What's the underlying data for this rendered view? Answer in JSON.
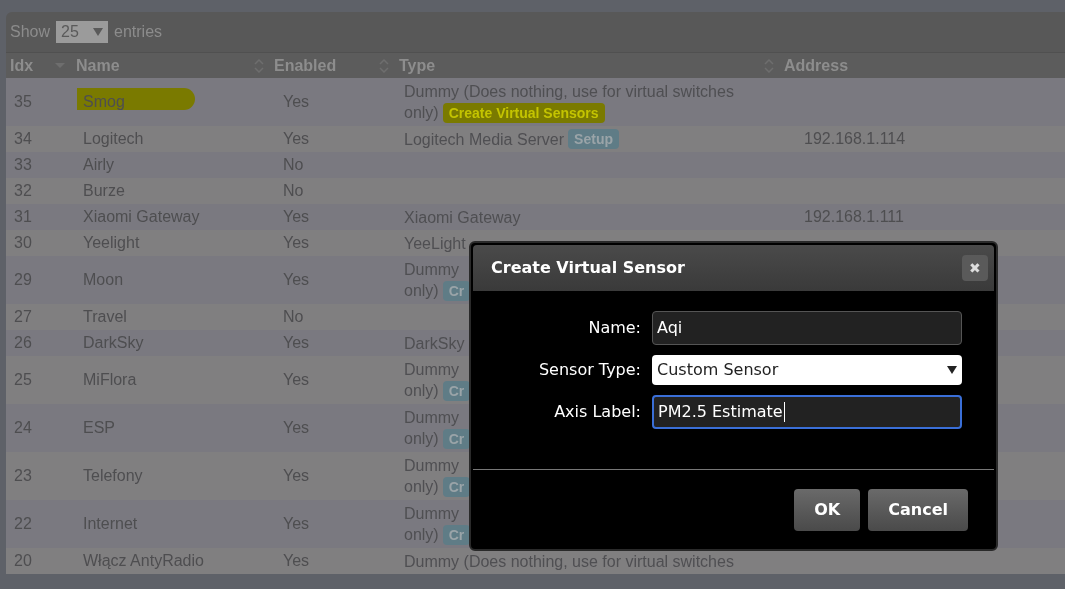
{
  "length_control": {
    "label_before": "Show",
    "value": "25",
    "label_after": "entries"
  },
  "table": {
    "columns": [
      {
        "label": "Idx",
        "sorted": true
      },
      {
        "label": "Name",
        "sorted": false
      },
      {
        "label": "Enabled",
        "sorted": false
      },
      {
        "label": "Type",
        "sorted": false
      },
      {
        "label": "Address"
      }
    ],
    "rows": [
      {
        "idx": "35",
        "name": "Smog",
        "enabled": "Yes",
        "type_lines": [
          "Dummy (Does nothing, use for virtual switches",
          "only)"
        ],
        "badge": "Create Virtual Sensors",
        "address": "",
        "highlighted": true
      },
      {
        "idx": "34",
        "name": "Logitech",
        "enabled": "Yes",
        "type_lines": [
          "Logitech Media Server"
        ],
        "badge": "Setup",
        "address": "192.168.1.114",
        "highlighted": false
      },
      {
        "idx": "33",
        "name": "Airly",
        "enabled": "No",
        "type_lines": [],
        "address": "",
        "highlighted": false
      },
      {
        "idx": "32",
        "name": "Burze",
        "enabled": "No",
        "type_lines": [],
        "address": "",
        "highlighted": false
      },
      {
        "idx": "31",
        "name": "Xiaomi Gateway",
        "enabled": "Yes",
        "type_lines": [
          "Xiaomi Gateway"
        ],
        "address": "192.168.1.111",
        "highlighted": false
      },
      {
        "idx": "30",
        "name": "Yeelight",
        "enabled": "Yes",
        "type_lines": [
          "YeeLight"
        ],
        "address": "",
        "highlighted": false
      },
      {
        "idx": "29",
        "name": "Moon",
        "enabled": "Yes",
        "type_lines": [
          "Dummy",
          "only)"
        ],
        "badge": "Cr",
        "address": "",
        "highlighted": false
      },
      {
        "idx": "27",
        "name": "Travel",
        "enabled": "No",
        "type_lines": [],
        "address": "",
        "highlighted": false
      },
      {
        "idx": "26",
        "name": "DarkSky",
        "enabled": "Yes",
        "type_lines": [
          "DarkSky"
        ],
        "address": "",
        "highlighted": false
      },
      {
        "idx": "25",
        "name": "MiFlora",
        "enabled": "Yes",
        "type_lines": [
          "Dummy",
          "only)"
        ],
        "badge": "Cr",
        "address": "",
        "highlighted": false
      },
      {
        "idx": "24",
        "name": "ESP",
        "enabled": "Yes",
        "type_lines": [
          "Dummy",
          "only)"
        ],
        "badge": "Cr",
        "address": "",
        "highlighted": false
      },
      {
        "idx": "23",
        "name": "Telefony",
        "enabled": "Yes",
        "type_lines": [
          "Dummy",
          "only)"
        ],
        "badge": "Cr",
        "address": "",
        "highlighted": false
      },
      {
        "idx": "22",
        "name": "Internet",
        "enabled": "Yes",
        "type_lines": [
          "Dummy",
          "only)"
        ],
        "badge": "Cr",
        "address": "",
        "highlighted": false
      },
      {
        "idx": "20",
        "name": "Włącz AntyRadio",
        "enabled": "Yes",
        "type_lines": [
          "Dummy (Does nothing, use for virtual switches"
        ],
        "address": "",
        "highlighted": false
      }
    ]
  },
  "dialog": {
    "title": "Create Virtual Sensor",
    "close": "✖",
    "fields": [
      {
        "kind": "input",
        "label": "Name:",
        "value": "Aqi",
        "focused": false
      },
      {
        "kind": "select",
        "label": "Sensor Type:",
        "value": "Custom Sensor",
        "focused": false
      },
      {
        "kind": "input",
        "label": "Axis Label:",
        "value": "PM2.5 Estimate",
        "focused": true
      }
    ],
    "buttons": [
      "OK",
      "Cancel"
    ]
  }
}
